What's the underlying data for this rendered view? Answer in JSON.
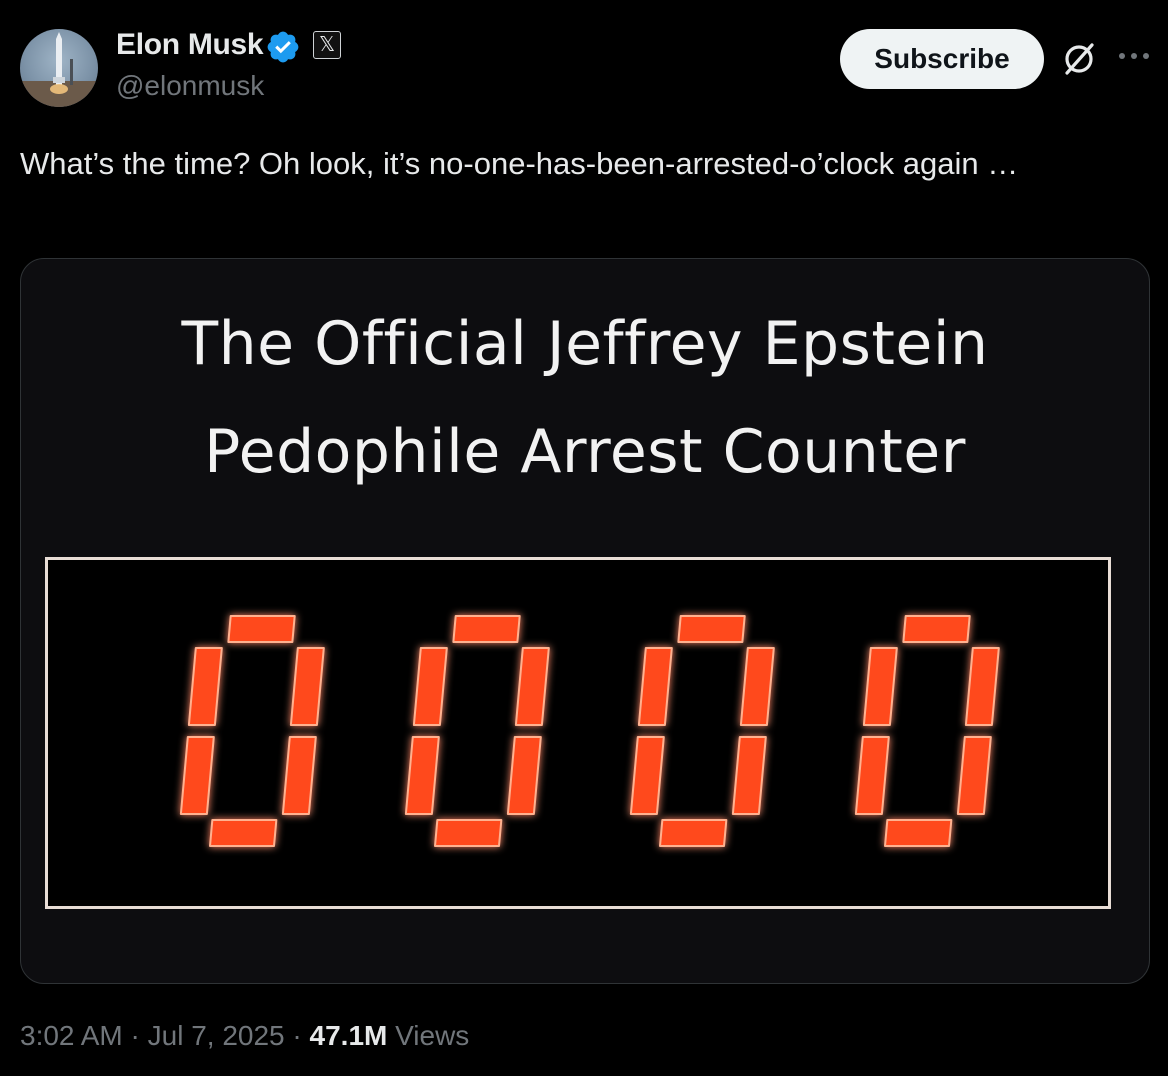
{
  "author": {
    "name": "Elon Musk",
    "handle": "@elonmusk",
    "verified_icon": "verified-badge-icon",
    "affiliate_icon": "x-logo-icon",
    "affiliate_glyph": "𝕏"
  },
  "actions": {
    "subscribe_label": "Subscribe",
    "grok_icon": "grok-icon",
    "more_icon": "more-icon"
  },
  "tweet": {
    "text": "What’s the time? Oh look, it’s no-one-has-been-arrested-o’clock again …"
  },
  "media": {
    "title_line_1": "The Official Jeffrey Epstein",
    "title_line_2": "Pedophile Arrest Counter",
    "counter_digits": [
      "0",
      "0",
      "0",
      "0"
    ],
    "counter_color": "#ff4a1f"
  },
  "footer": {
    "time": "3:02 AM",
    "separator": "·",
    "date": "Jul 7, 2025",
    "views_count": "47.1M",
    "views_label": "Views"
  },
  "colors": {
    "accent_blue": "#1d9bf0",
    "muted_text": "#71767b",
    "primary_text": "#e7e9ea"
  }
}
